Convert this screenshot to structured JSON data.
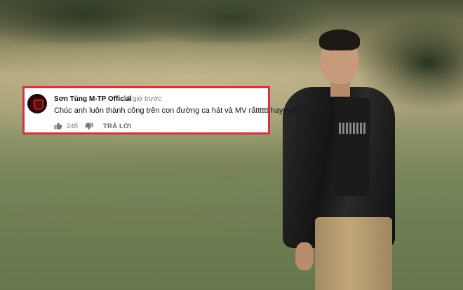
{
  "comment": {
    "author": "Sơn Tùng M-TP Official",
    "timestamp": "16 giờ trước",
    "text": "Chúc anh luôn thành công trên con đường ca hát và MV rấtttttt hayyy!!!!",
    "like_count": "248",
    "reply_label": "TRẢ LỜI",
    "icons": {
      "like": "thumbs-up-icon",
      "dislike": "thumbs-down-icon"
    },
    "border_color": "#d6323f"
  }
}
